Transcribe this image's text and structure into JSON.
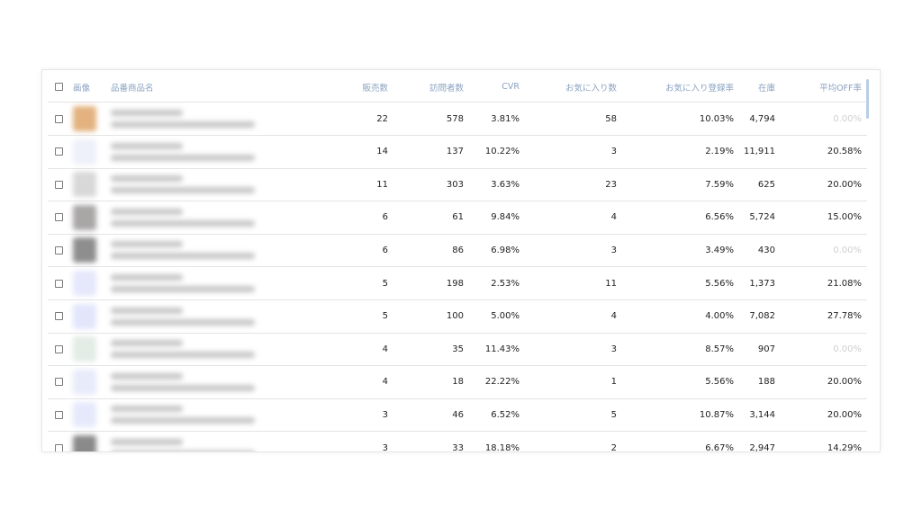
{
  "table": {
    "headers": {
      "image": "画像",
      "name": "品番商品名",
      "sales": "販売数",
      "visitors": "訪問者数",
      "cvr": "CVR",
      "favorites": "お気に入り数",
      "fav_rate": "お気に入り登録率",
      "stock": "在庫",
      "avg_off": "平均OFF率"
    },
    "rows": [
      {
        "sales": "22",
        "visitors": "578",
        "cvr": "3.81%",
        "favorites": "58",
        "fav_rate": "10.03%",
        "stock": "4,794",
        "avg_off": "0.00%",
        "thumb_color": "#e3b27f"
      },
      {
        "sales": "14",
        "visitors": "137",
        "cvr": "10.22%",
        "favorites": "3",
        "fav_rate": "2.19%",
        "stock": "11,911",
        "avg_off": "20.58%",
        "thumb_color": "#eef0fa"
      },
      {
        "sales": "11",
        "visitors": "303",
        "cvr": "3.63%",
        "favorites": "23",
        "fav_rate": "7.59%",
        "stock": "625",
        "avg_off": "20.00%",
        "thumb_color": "#d8d8d8"
      },
      {
        "sales": "6",
        "visitors": "61",
        "cvr": "9.84%",
        "favorites": "4",
        "fav_rate": "6.56%",
        "stock": "5,724",
        "avg_off": "15.00%",
        "thumb_color": "#a9a6a6"
      },
      {
        "sales": "6",
        "visitors": "86",
        "cvr": "6.98%",
        "favorites": "3",
        "fav_rate": "3.49%",
        "stock": "430",
        "avg_off": "0.00%",
        "thumb_color": "#8e8e8e"
      },
      {
        "sales": "5",
        "visitors": "198",
        "cvr": "2.53%",
        "favorites": "11",
        "fav_rate": "5.56%",
        "stock": "1,373",
        "avg_off": "21.08%",
        "thumb_color": "#e5e8fb"
      },
      {
        "sales": "5",
        "visitors": "100",
        "cvr": "5.00%",
        "favorites": "4",
        "fav_rate": "4.00%",
        "stock": "7,082",
        "avg_off": "27.78%",
        "thumb_color": "#e3e6fb"
      },
      {
        "sales": "4",
        "visitors": "35",
        "cvr": "11.43%",
        "favorites": "3",
        "fav_rate": "8.57%",
        "stock": "907",
        "avg_off": "0.00%",
        "thumb_color": "#e4ece6"
      },
      {
        "sales": "4",
        "visitors": "18",
        "cvr": "22.22%",
        "favorites": "1",
        "fav_rate": "5.56%",
        "stock": "188",
        "avg_off": "20.00%",
        "thumb_color": "#e8ebfa"
      },
      {
        "sales": "3",
        "visitors": "46",
        "cvr": "6.52%",
        "favorites": "5",
        "fav_rate": "10.87%",
        "stock": "3,144",
        "avg_off": "20.00%",
        "thumb_color": "#e6e9fb"
      },
      {
        "sales": "3",
        "visitors": "33",
        "cvr": "18.18%",
        "favorites": "2",
        "fav_rate": "6.67%",
        "stock": "2,947",
        "avg_off": "14.29%",
        "thumb_color": "#8a8a8a"
      }
    ]
  },
  "colors": {
    "header_text": "#8aa2c0",
    "muted_text": "#cfcfcf",
    "scrollbar": "#b7cde6"
  }
}
